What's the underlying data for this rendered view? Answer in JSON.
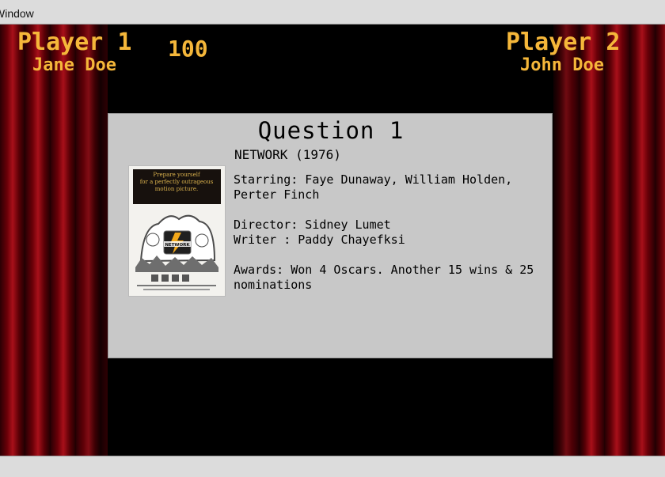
{
  "window": {
    "title": "Window"
  },
  "player1": {
    "label": "Player 1",
    "name": "Jane Doe"
  },
  "player2": {
    "label": "Player 2",
    "name": "John Doe"
  },
  "score": "100",
  "question": {
    "title": "Question 1",
    "movie_title": "NETWORK (1976)",
    "starring": "Starring: Faye Dunaway, William Holden, Perter Finch",
    "director": "Director: Sidney Lumet",
    "writer": "Writer : Paddy Chayefksi",
    "awards": "Awards: Won 4 Oscars. Another 15 wins & 25 nominations"
  },
  "poster": {
    "tagline": "Prepare yourself for a perfectly outrageous motion picture.",
    "logo": "NETWORK"
  },
  "colors": {
    "accent": "#f5b73a",
    "panel": "#c8c8c8",
    "curtain": "#a8101a"
  }
}
